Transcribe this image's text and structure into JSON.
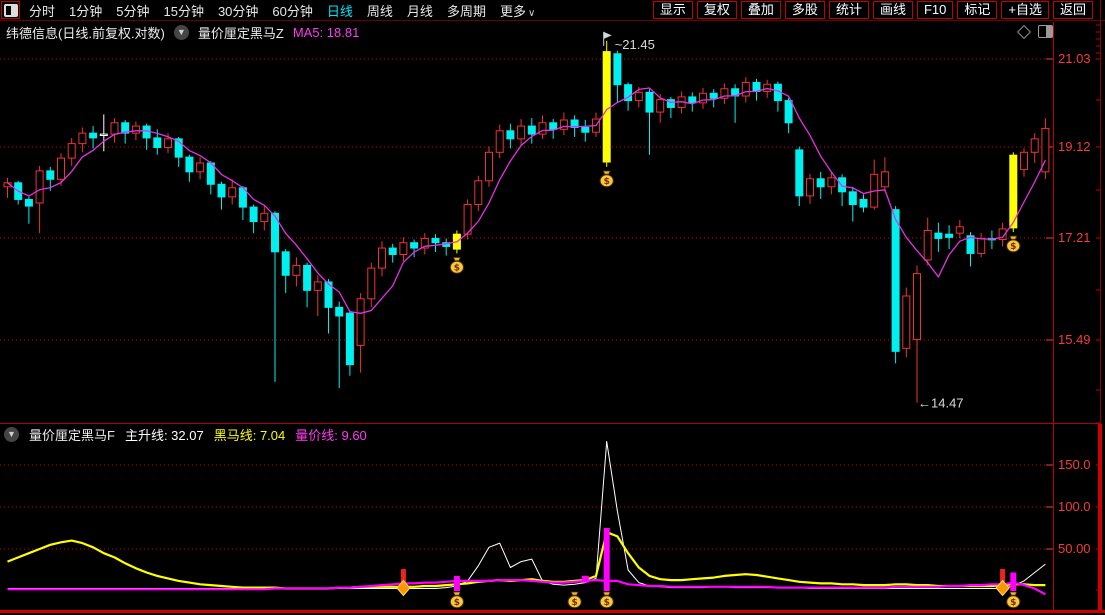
{
  "topbar": {
    "menu_items": [
      {
        "label": "分时",
        "active": false
      },
      {
        "label": "1分钟",
        "active": false
      },
      {
        "label": "5分钟",
        "active": false
      },
      {
        "label": "15分钟",
        "active": false
      },
      {
        "label": "30分钟",
        "active": false
      },
      {
        "label": "60分钟",
        "active": false
      },
      {
        "label": "日线",
        "active": true
      },
      {
        "label": "周线",
        "active": false
      },
      {
        "label": "月线",
        "active": false
      },
      {
        "label": "多周期",
        "active": false
      },
      {
        "label": "更多",
        "active": false,
        "chevron": "∨"
      }
    ],
    "right_buttons": [
      "显示",
      "复权",
      "叠加",
      "多股",
      "统计",
      "画线",
      "F10",
      "标记",
      "+自选",
      "返回"
    ]
  },
  "main_panel": {
    "title": "纬德信息(日线.前复权.对数)",
    "indicator_name": "量价厘定黑马Z",
    "ma5_label": "MA5: 18.81"
  },
  "sub_panel": {
    "title": "量价厘定黑马F",
    "legend": [
      {
        "label": "主升线: 32.07",
        "color": "#ffffff"
      },
      {
        "label": "黑马线: 7.04",
        "color": "#ffff00"
      },
      {
        "label": "量价线: 9.60",
        "color": "#ff00ff"
      }
    ]
  },
  "colors": {
    "up": "#ee3333",
    "down": "#00f0f0",
    "signal": "#ffff00",
    "doji": "#ffffff",
    "ma5": "#e233e2",
    "axis_text": "#f53b3b",
    "grid": "#d40000",
    "annotation": "#d8d8d8"
  },
  "chart_data": {
    "main": {
      "type": "candlestick",
      "y_axis": {
        "scale": "log",
        "price_ticks": [
          {
            "label": "21.03",
            "price": 21.03,
            "y": 59
          },
          {
            "label": "19.12",
            "price": 19.12,
            "y": 147
          },
          {
            "label": "17.21",
            "price": 17.21,
            "y": 238
          },
          {
            "label": "15.49",
            "price": 15.49,
            "y": 340
          }
        ]
      },
      "candles": [
        [
          18.3,
          18.38,
          18.08,
          18.48
        ],
        [
          18.38,
          18.05,
          17.95,
          18.42
        ],
        [
          18.05,
          17.92,
          17.58,
          18.1
        ],
        [
          17.98,
          18.62,
          17.4,
          18.72
        ],
        [
          18.62,
          18.45,
          18.22,
          18.7
        ],
        [
          18.45,
          18.88,
          18.32,
          18.98
        ],
        [
          18.88,
          19.18,
          18.72,
          19.3
        ],
        [
          19.18,
          19.4,
          19.0,
          19.52
        ],
        [
          19.4,
          19.3,
          19.08,
          19.55
        ],
        [
          19.35,
          19.38,
          19.02,
          19.8,
          "w"
        ],
        [
          19.38,
          19.62,
          19.2,
          19.72
        ],
        [
          19.62,
          19.4,
          19.18,
          19.68
        ],
        [
          19.4,
          19.55,
          19.25,
          19.65
        ],
        [
          19.55,
          19.3,
          19.05,
          19.6
        ],
        [
          19.3,
          19.1,
          18.95,
          19.48
        ],
        [
          19.1,
          19.28,
          18.98,
          19.4
        ],
        [
          19.28,
          18.9,
          18.7,
          19.32
        ],
        [
          18.9,
          18.6,
          18.4,
          18.95
        ],
        [
          18.6,
          18.78,
          18.45,
          18.9
        ],
        [
          18.78,
          18.35,
          18.15,
          18.82
        ],
        [
          18.35,
          18.1,
          17.85,
          18.4
        ],
        [
          18.1,
          18.28,
          17.95,
          18.45
        ],
        [
          18.28,
          17.9,
          17.65,
          18.32
        ],
        [
          17.9,
          17.62,
          17.4,
          17.95
        ],
        [
          17.62,
          17.78,
          17.45,
          17.92
        ],
        [
          17.78,
          17.05,
          14.8,
          17.82
        ],
        [
          17.05,
          16.62,
          16.3,
          17.1
        ],
        [
          16.62,
          16.8,
          16.42,
          16.95
        ],
        [
          16.8,
          16.35,
          16.05,
          16.85
        ],
        [
          16.35,
          16.5,
          15.9,
          16.62
        ],
        [
          16.5,
          16.05,
          15.6,
          16.55
        ],
        [
          16.05,
          15.9,
          14.7,
          16.15
        ],
        [
          15.95,
          15.08,
          14.9,
          16.0
        ],
        [
          15.4,
          16.2,
          14.95,
          16.3
        ],
        [
          16.2,
          16.75,
          16.05,
          16.85
        ],
        [
          16.75,
          17.12,
          16.6,
          17.25
        ],
        [
          17.12,
          17.0,
          16.85,
          17.2
        ],
        [
          17.0,
          17.22,
          16.88,
          17.32
        ],
        [
          17.22,
          17.12,
          16.95,
          17.28
        ],
        [
          17.12,
          17.3,
          17.0,
          17.4
        ],
        [
          17.3,
          17.22,
          17.05,
          17.38
        ],
        [
          17.22,
          17.15,
          16.98,
          17.3
        ],
        [
          17.1,
          17.38,
          17.02,
          17.45,
          "y"
        ],
        [
          17.38,
          17.95,
          17.28,
          18.05
        ],
        [
          17.95,
          18.42,
          17.82,
          18.52
        ],
        [
          18.42,
          19.0,
          18.3,
          19.12
        ],
        [
          19.0,
          19.45,
          18.88,
          19.58
        ],
        [
          19.45,
          19.28,
          19.08,
          19.6
        ],
        [
          19.28,
          19.55,
          19.15,
          19.7
        ],
        [
          19.55,
          19.38,
          19.18,
          19.72
        ],
        [
          19.38,
          19.62,
          19.28,
          19.78
        ],
        [
          19.62,
          19.48,
          19.28,
          19.7
        ],
        [
          19.48,
          19.68,
          19.36,
          19.84
        ],
        [
          19.68,
          19.52,
          19.32,
          19.78
        ],
        [
          19.52,
          19.42,
          19.22,
          19.68
        ],
        [
          19.42,
          19.7,
          19.32,
          19.84
        ],
        [
          18.8,
          21.2,
          18.7,
          21.45,
          "y"
        ],
        [
          21.15,
          20.45,
          20.05,
          21.22
        ],
        [
          20.45,
          20.1,
          19.88,
          20.5
        ],
        [
          20.1,
          20.28,
          19.95,
          20.4
        ],
        [
          20.28,
          19.85,
          18.95,
          20.35
        ],
        [
          19.85,
          20.12,
          19.62,
          20.24
        ],
        [
          20.12,
          19.95,
          19.72,
          20.18
        ],
        [
          19.95,
          20.18,
          19.82,
          20.3
        ],
        [
          20.18,
          20.05,
          19.86,
          20.28
        ],
        [
          20.05,
          20.26,
          19.92,
          20.38
        ],
        [
          20.26,
          20.15,
          19.95,
          20.35
        ],
        [
          20.15,
          20.36,
          20.02,
          20.48
        ],
        [
          20.36,
          20.2,
          19.62,
          20.46
        ],
        [
          20.2,
          20.5,
          20.06,
          20.62
        ],
        [
          20.5,
          20.3,
          20.1,
          20.58
        ],
        [
          20.3,
          20.46,
          20.16,
          20.56
        ],
        [
          20.46,
          20.1,
          19.86,
          20.52
        ],
        [
          20.1,
          19.62,
          19.4,
          20.16
        ],
        [
          19.05,
          18.12,
          17.92,
          19.12
        ],
        [
          18.12,
          18.46,
          17.96,
          18.56
        ],
        [
          18.46,
          18.3,
          18.06,
          18.6
        ],
        [
          18.3,
          18.48,
          18.15,
          18.6
        ],
        [
          18.48,
          18.2,
          17.92,
          18.55
        ],
        [
          18.2,
          17.95,
          17.62,
          18.3
        ],
        [
          18.05,
          17.9,
          17.8,
          18.15
        ],
        [
          17.9,
          18.55,
          17.85,
          18.85
        ],
        [
          18.3,
          18.6,
          18.2,
          18.9
        ],
        [
          17.85,
          15.3,
          15.1,
          17.92
        ],
        [
          15.35,
          16.25,
          15.2,
          16.4
        ],
        [
          15.5,
          16.65,
          14.47,
          16.8
        ],
        [
          16.9,
          17.45,
          16.8,
          17.7
        ],
        [
          17.4,
          17.3,
          17.05,
          17.6
        ],
        [
          17.38,
          17.32,
          17.1,
          17.55
        ],
        [
          17.4,
          17.52,
          17.3,
          17.65
        ],
        [
          17.35,
          17.02,
          16.78,
          17.42
        ],
        [
          17.02,
          17.3,
          16.95,
          17.4
        ],
        [
          17.3,
          17.28,
          17.1,
          17.45
        ],
        [
          17.28,
          17.48,
          17.15,
          17.6
        ],
        [
          17.5,
          18.94,
          17.42,
          19.0,
          "y"
        ],
        [
          18.65,
          19.0,
          18.5,
          19.08
        ],
        [
          19.0,
          19.28,
          18.78,
          19.4
        ],
        [
          18.6,
          19.5,
          18.45,
          19.72
        ]
      ],
      "money_bag_indices": [
        42,
        56,
        94
      ],
      "annotations": {
        "high_flag": {
          "index": 56,
          "text": "~21.45"
        },
        "low_arrow": {
          "index": 85,
          "text": "←14.47"
        }
      }
    },
    "sub": {
      "type": "line",
      "y_ticks": [
        {
          "label": "150.0",
          "value": 150
        },
        {
          "label": "100.0",
          "value": 100
        },
        {
          "label": "50.00",
          "value": 50
        }
      ],
      "series": [
        {
          "name": "主升线",
          "color": "#ffffff",
          "width": 1,
          "values": [
            3,
            3,
            3,
            3,
            3,
            3,
            3,
            3,
            3,
            3,
            3,
            3,
            3,
            3,
            3,
            3,
            3,
            3,
            3,
            3,
            3,
            3,
            3,
            3,
            3,
            3,
            3,
            3,
            3,
            3,
            3,
            3,
            3,
            3,
            3,
            3,
            3,
            3,
            3,
            3,
            3,
            4,
            6,
            12,
            30,
            52,
            57,
            28,
            35,
            38,
            12,
            8,
            7,
            8,
            10,
            15,
            178,
            95,
            25,
            10,
            6,
            5,
            4,
            4,
            4,
            4,
            5,
            5,
            4,
            4,
            4,
            4,
            4,
            4,
            4,
            3,
            3,
            3,
            3,
            3,
            3,
            3,
            3,
            3,
            3,
            3,
            3,
            3,
            3,
            3,
            3,
            3,
            3,
            3,
            6,
            12,
            22,
            32.07
          ]
        },
        {
          "name": "黑马线",
          "color": "#ffff00",
          "width": 2.2,
          "values": [
            35,
            40,
            45,
            50,
            55,
            58,
            60,
            57,
            52,
            45,
            40,
            33,
            27,
            22,
            18,
            15,
            12,
            10,
            8,
            7,
            6,
            5,
            4,
            4,
            4,
            4,
            3,
            3,
            3,
            3,
            3,
            4,
            4,
            5,
            5,
            5,
            5,
            5,
            5,
            6,
            6,
            7,
            8,
            9,
            11,
            12,
            13,
            12,
            13,
            14,
            12,
            11,
            11,
            12,
            13,
            18,
            70,
            65,
            45,
            28,
            18,
            14,
            13,
            13,
            14,
            15,
            16,
            18,
            19,
            20,
            19,
            17,
            15,
            13,
            11,
            10,
            9,
            9,
            8,
            8,
            7,
            7,
            7,
            8,
            8,
            7,
            7,
            6,
            6,
            6,
            6,
            6,
            6,
            7,
            8,
            8,
            7,
            7.04
          ]
        },
        {
          "name": "量价线",
          "color": "#ff00ff",
          "width": 2.2,
          "values": [
            2,
            2,
            2,
            2,
            2,
            2,
            2,
            2,
            2,
            2,
            2,
            2,
            2,
            2,
            2,
            2,
            2,
            2,
            2,
            2,
            2,
            2,
            2,
            2,
            2,
            3,
            3,
            3,
            3,
            3,
            3,
            4,
            4,
            5,
            6,
            7,
            8,
            9,
            9,
            10,
            10,
            11,
            12,
            12,
            12,
            12,
            13,
            13,
            13,
            12,
            11,
            10,
            10,
            11,
            12,
            13,
            12,
            12,
            8,
            7,
            6,
            6,
            5,
            5,
            5,
            5,
            5,
            5,
            5,
            5,
            5,
            5,
            4,
            4,
            4,
            4,
            4,
            4,
            4,
            4,
            4,
            4,
            4,
            5,
            5,
            5,
            5,
            5,
            6,
            6,
            7,
            7,
            8,
            8,
            10,
            7,
            3,
            -4
          ]
        }
      ],
      "magenta_bars": [
        {
          "index": 42,
          "value": 18
        },
        {
          "index": 56,
          "value": 75
        },
        {
          "index": 94,
          "value": 22
        }
      ],
      "magenta_squares": [
        {
          "index": 54,
          "value": 14
        }
      ],
      "diamond_marker_indices": [
        37,
        93
      ],
      "money_bag_indices": [
        42,
        53,
        56,
        94
      ]
    }
  }
}
